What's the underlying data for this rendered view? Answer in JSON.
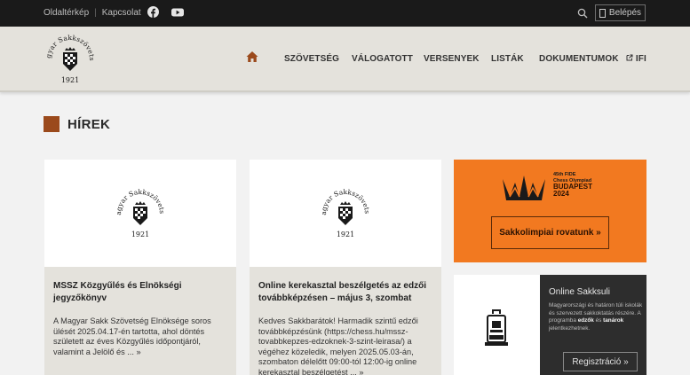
{
  "topbar": {
    "sitemap_label": "Oldaltérkép",
    "separator": "|",
    "contact_label": "Kapcsolat",
    "login_label": "Belépés"
  },
  "header": {
    "logo_text_top": "Magyar Sakkszövetség",
    "logo_year": "1921",
    "nav": {
      "federation": "SZÖVETSÉG",
      "national_team": "VÁLOGATOTT",
      "competitions": "VERSENYEK",
      "lists": "LISTÁK",
      "documents": "DOKUMENTUMOK",
      "ifi": "IFI"
    }
  },
  "section": {
    "title": "HÍREK"
  },
  "news": [
    {
      "logo_text": "Magyar Sakkszövetség",
      "logo_year": "1921",
      "title": "MSSZ Közgyűlés és Elnökségi jegyzőkönyv",
      "excerpt": "A Magyar Sakk Szövetség Elnöksége soros ülését 2025.04.17-én tartotta, ahol döntés született az éves Közgyűlés időpontjáról, valamint a Jelölő és ... »"
    },
    {
      "logo_text": "Magyar Sakkszövetség",
      "logo_year": "1921",
      "title": "Online kerekasztal beszélgetés az edzői továbbképzésen – május 3, szombat",
      "excerpt": "Kedves Sakkbarátok!  Harmadik szintű edzői továbbképzésünk (https://chess.hu/mssz-tovabbkepzes-edzoknek-3-szint-leirasa/) a végéhez közeledik, melyen 2025.05.03-án, szombaton délelőtt 09:00-tól 12:00-ig online kerekasztal beszélgetést ... »"
    }
  ],
  "olympiad": {
    "line1": "45th FIDE",
    "line2": "Chess Olympiad",
    "city": "BUDAPEST",
    "year": "2024",
    "button_label": "Sakkolimpiai rovatunk »"
  },
  "sakksuli": {
    "title": "Online Sakksuli",
    "desc_before": "Magyarországi és határon túli iskolák és szervezett sakkoktatás részére. A programba ",
    "desc_bold1": "edzők",
    "desc_mid": " és ",
    "desc_bold2": "tanárok",
    "desc_after": " jelentkezhetnek.",
    "button_label": "Regisztráció »"
  },
  "colors": {
    "accent": "#9b4a1c",
    "olympiad_orange": "#f27920",
    "topbar": "#1a1a1a",
    "header_bg": "#e4e2dc"
  }
}
